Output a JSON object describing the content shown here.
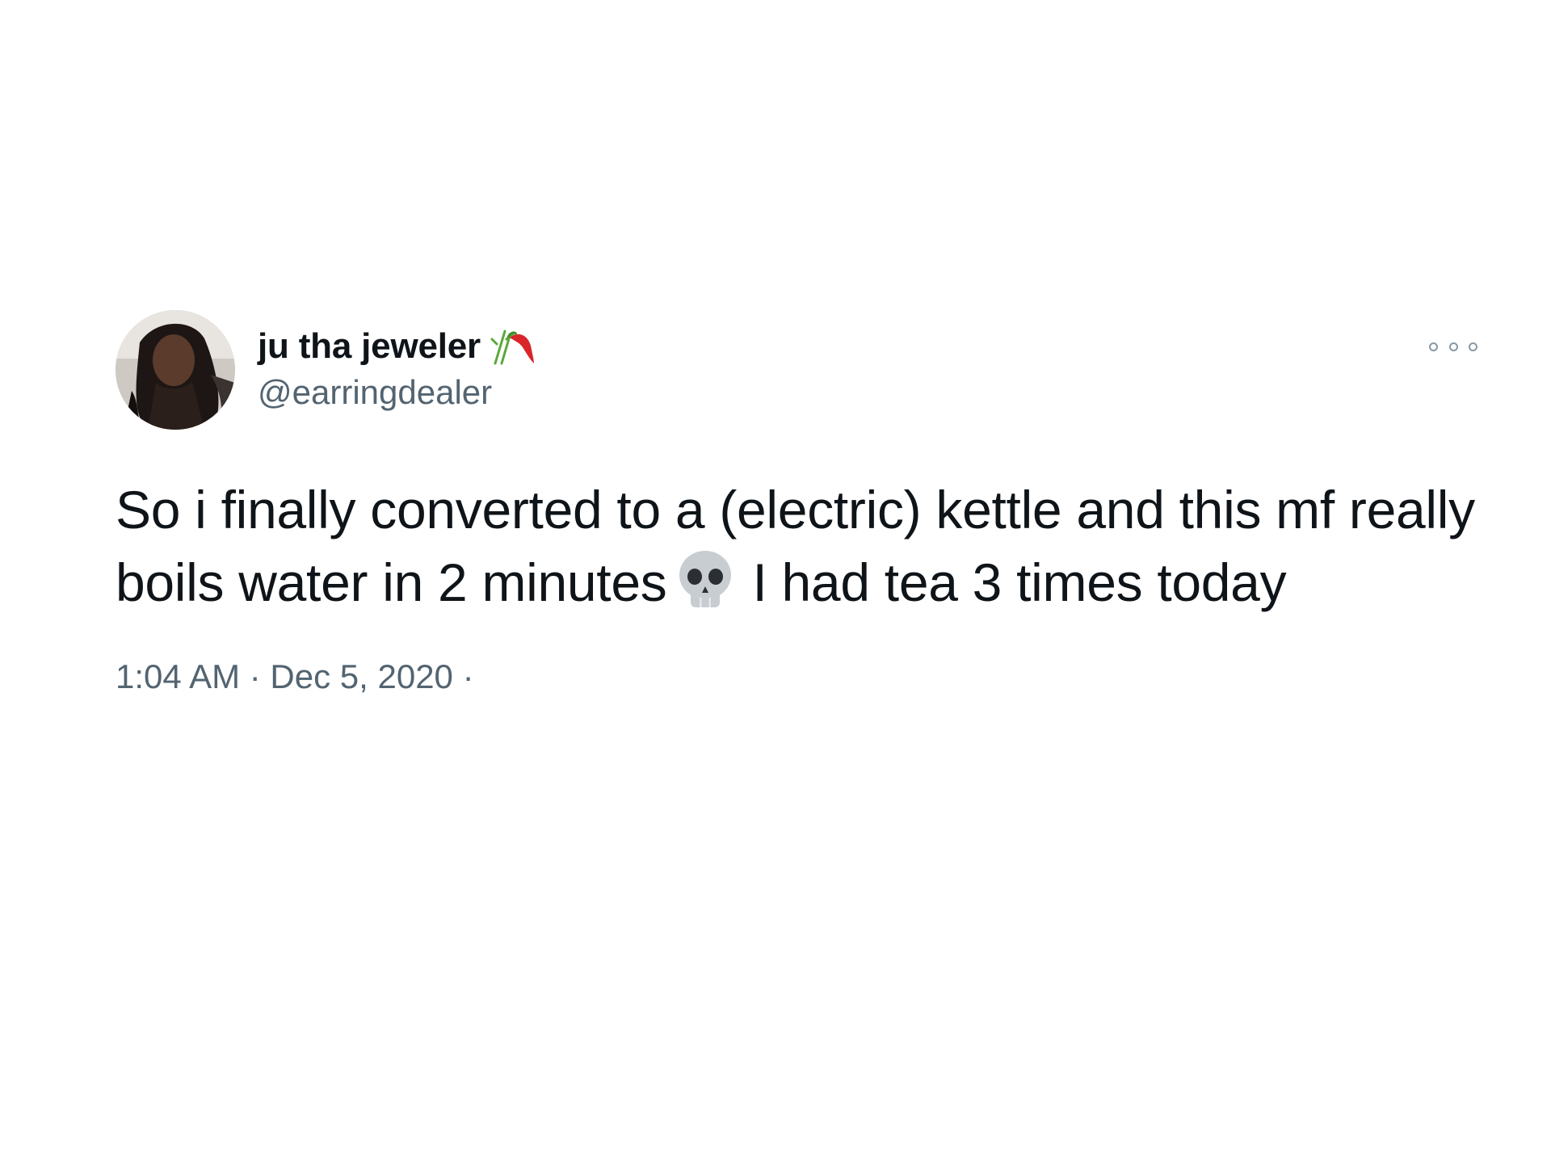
{
  "tweet": {
    "display_name": "ju tha jeweler",
    "handle": "@earringdealer",
    "text_part1": "So i finally converted to a (electric)  kettle and this mf really boils water in 2 minutes",
    "text_part2": "I had tea 3 times today",
    "timestamp": "1:04 AM · Dec 5, 2020 ·",
    "icons": {
      "avatar": "avatar",
      "name_emoji": "bamboo-chili-emoji-icon",
      "inline_emoji": "skull-icon",
      "more": "more-options-icon"
    }
  },
  "colors": {
    "background": "#ffffff",
    "primary_text": "#0f1419",
    "secondary_text": "#536471"
  }
}
